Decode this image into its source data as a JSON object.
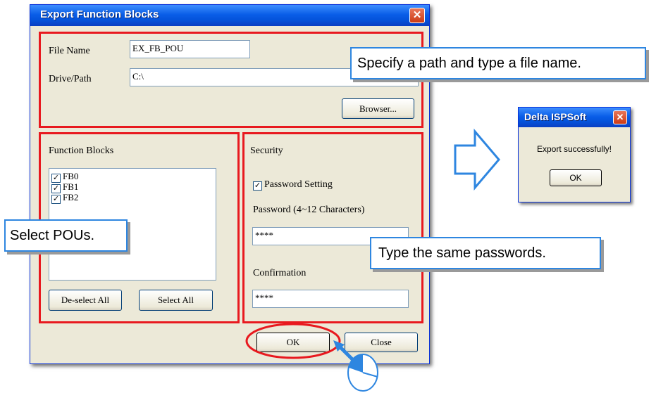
{
  "export_dialog": {
    "title": "Export Function Blocks",
    "file_name_label": "File Name",
    "file_name_value": "EX_FB_POU",
    "drive_path_label": "Drive/Path",
    "drive_path_value": "C:\\",
    "browser_button": "Browser...",
    "function_blocks_label": "Function Blocks",
    "function_blocks": [
      {
        "label": "FB0",
        "checked": true
      },
      {
        "label": "FB1",
        "checked": true
      },
      {
        "label": "FB2",
        "checked": true
      }
    ],
    "deselect_all_button": "De-select All",
    "select_all_button": "Select All",
    "security_label": "Security",
    "password_setting_label": "Password Setting",
    "password_setting_checked": true,
    "password_label": "Password (4~12 Characters)",
    "password_value": "****",
    "confirmation_label": "Confirmation",
    "confirmation_value": "****",
    "ok_button": "OK",
    "close_button": "Close",
    "close_icon": "close-icon"
  },
  "result_dialog": {
    "title": "Delta ISPSoft",
    "message": "Export successfully!",
    "ok_button": "OK",
    "close_icon": "close-icon"
  },
  "callouts": {
    "path_hint": "Specify a path and type a file name.",
    "select_hint": "Select POUs.",
    "password_hint": "Type the same passwords."
  },
  "colors": {
    "highlight_red": "#e8191f",
    "callout_blue": "#2e86e0",
    "titlebar_blue": "#0a5ee8"
  },
  "icons": {
    "arrow": "right-arrow-icon",
    "cursor": "mouse-cursor-icon"
  }
}
